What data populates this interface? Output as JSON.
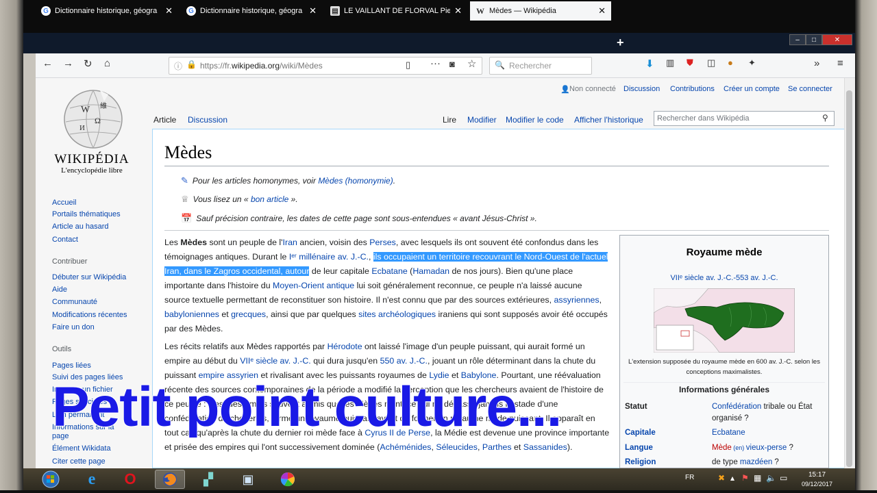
{
  "browser": {
    "tabs": [
      {
        "label": "Dictionnaire historique, géogra",
        "favicon": "G"
      },
      {
        "label": "Dictionnaire historique, géogra",
        "favicon": "G"
      },
      {
        "label": "LE VAILLANT DE FLORVAL Pier",
        "favicon": "doc"
      },
      {
        "label": "Mèdes — Wikipédia",
        "favicon": "W"
      }
    ],
    "new_tab": "+",
    "url_prefix": "https://fr.",
    "url_domain": "wikipedia.org",
    "url_path": "/wiki/Mèdes",
    "search_placeholder": "Rechercher"
  },
  "wiki": {
    "logo_title": "WIKIPÉDIA",
    "logo_subtitle": "L'encyclopédie libre",
    "user_links": {
      "not_connected": "Non connecté",
      "discussion": "Discussion",
      "contributions": "Contributions",
      "create_account": "Créer un compte",
      "login": "Se connecter"
    },
    "page_tabs": {
      "article": "Article",
      "discussion": "Discussion",
      "read": "Lire",
      "edit": "Modifier",
      "edit_code": "Modifier le code",
      "history": "Afficher l'historique",
      "search_placeholder": "Rechercher dans Wikipédia"
    },
    "sidebar": {
      "nav": [
        "Accueil",
        "Portails thématiques",
        "Article au hasard",
        "Contact"
      ],
      "contribute_heading": "Contribuer",
      "contribute": [
        "Débuter sur Wikipédia",
        "Aide",
        "Communauté",
        "Modifications récentes",
        "Faire un don"
      ],
      "tools_heading": "Outils",
      "tools": [
        "Pages liées",
        "Suivi des pages liées",
        "Importer un fichier",
        "Pages spéciales",
        "Lien permanent",
        "Informations sur la",
        "page",
        "Élément Wikidata",
        "Citer cette page"
      ]
    },
    "title": "Mèdes",
    "hatnotes": {
      "homonymy_prefix": "Pour les articles homonymes, voir ",
      "homonymy_link": "Mèdes (homonymie)",
      "homonymy_suffix": ".",
      "good_prefix": "Vous lisez un « ",
      "good_link": "bon article",
      "good_suffix": " ».",
      "dates": "Sauf précision contraire, les dates de cette page sont sous-entendues « avant Jésus-Christ »."
    },
    "p1": {
      "t1": "Les ",
      "medes": "Mèdes",
      "t2": " sont un peuple de l'",
      "iran": "Iran",
      "t3": " ancien, voisin des ",
      "perses": "Perses",
      "t4": ", avec lesquels ils ont souvent été confondus dans les témoignages antiques. Durant le ",
      "millenaire": "Iᵉʳ millénaire av. J.-C.",
      "t5": ", ",
      "highlight": "ils occupaient un territoire recouvrant le Nord-Ouest de l'actuel Iran, dans le Zagros occidental, autour",
      "t6": " de leur capitale ",
      "ecbatane": "Ecbatane",
      "t7": " (",
      "hamadan": "Hamadan",
      "t8": " de nos jours). Bien qu'une place importante dans l'histoire du ",
      "moyen_orient": "Moyen-Orient antique",
      "t9": " lui soit généralement reconnue, ce peuple n'a laissé aucune source textuelle permettant de reconstituer son histoire. Il n'est connu que par des sources extérieures, ",
      "assyriennes": "assyriennes",
      "t10": ", ",
      "babyloniennes": "babyloniennes",
      "t11": " et ",
      "grecques": "grecques",
      "t12": ", ainsi que par quelques ",
      "sites": "sites archéologiques",
      "t13": " iraniens qui sont supposés avoir été occupés par des Mèdes."
    },
    "p2": {
      "t1": "Les récits relatifs aux Mèdes rapportés par ",
      "herodote": "Hérodote",
      "t2": " ont laissé l'image d'un peuple puissant, qui aurait formé un empire au début du ",
      "siecle": "VIIᵉ siècle av. J.-C.",
      "t3": " qui dura jusqu'en ",
      "date550": "550 av. J.-C.",
      "t4": ", jouant un rôle déterminant dans la chute du puissant ",
      "empire_assyrien": "empire assyrien",
      "t5": " et rivalisant avec les puissants royaumes de ",
      "lydie": "Lydie",
      "t6": " et ",
      "babylone": "Babylone",
      "t7": ". Pourtant, une réévaluation récente des sources contemporaines de la période a modifié la perception que les ",
      "t8": "chercheurs avaient de l'histoire de ce peuple : il est désormais souvent admis que les Mèdes n'ont, ce qui ",
      "t9": "ne dépassa jamais le stade d'une confédération de chefferies, formé un royaume puissant avant de former un ",
      "t10": "royaume mède puissant. Il apparaît en tout cas qu'après la chute du dernier roi mède face à ",
      "cyrus": "Cyrus II de Perse",
      "t11": ", la Médie est devenue une province importante et prisée des empires qui l'ont successivement dominée (",
      "achemenides": "Achéménides",
      "t12": ", ",
      "seleucides": "Séleucides",
      "t13": ", ",
      "parthes": "Parthes",
      "t14": " et ",
      "sassanides": "Sassanides",
      "t15": ")."
    },
    "infobox": {
      "title": "Royaume mède",
      "period": "VIIᵉ siècle av. J.-C.-553 av. J.-C.",
      "caption": "L'extension supposée du royaume mède en 600 av. J.-C. selon les conceptions maximalistes.",
      "section": "Informations générales",
      "rows": [
        {
          "label": "Statut",
          "value_link": "Confédération",
          "value_text": " tribale ou État organisé ?"
        },
        {
          "label": "Capitale",
          "value_link": "Ecbatane",
          "value_text": ""
        },
        {
          "label": "Langue",
          "value_link": "Mède",
          "value_extra": " (en) ",
          "value_link2": "vieux-perse",
          "value_text": " ?"
        },
        {
          "label": "Religion",
          "value_text": "de type ",
          "value_link": "mazdéen",
          "value_text2": " ?"
        }
      ]
    }
  },
  "overlay_caption": "Petit point culture...",
  "taskbar": {
    "lang": "FR",
    "time": "15:17",
    "date": "09/12/2017"
  },
  "colors": {
    "overlay": "#1a1ae6",
    "link": "#0645ad",
    "highlight": "#3399ff",
    "tabbar": "#0f1a2b"
  }
}
